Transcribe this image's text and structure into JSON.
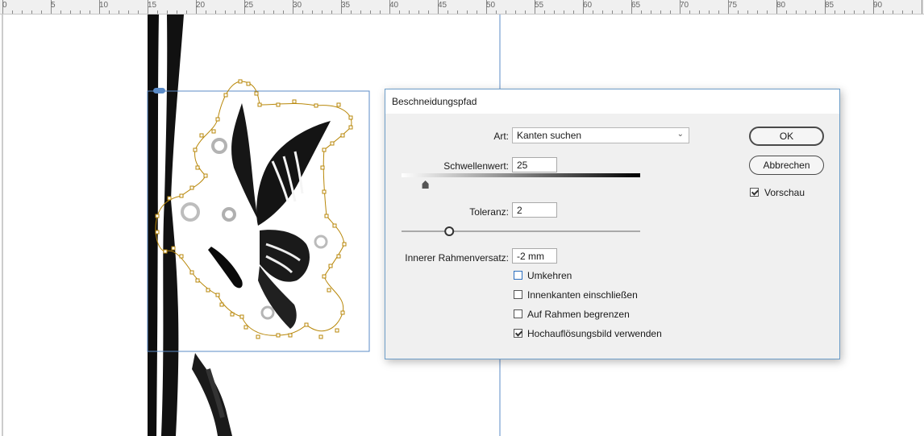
{
  "ruler": {
    "labels": [
      "0",
      "5",
      "10",
      "15",
      "20",
      "25",
      "30",
      "35",
      "40",
      "45",
      "50",
      "55",
      "60",
      "65",
      "70",
      "75",
      "80",
      "85",
      "90"
    ]
  },
  "dialog": {
    "title": "Beschneidungspfad",
    "type": {
      "label": "Art:",
      "value": "Kanten suchen"
    },
    "threshold": {
      "label": "Schwellenwert:",
      "value": "25",
      "slider_fraction": 0.1
    },
    "tolerance": {
      "label": "Toleranz:",
      "value": "2",
      "slider_fraction": 0.2
    },
    "inset": {
      "label": "Innerer Rahmenversatz:",
      "value": "-2 mm"
    },
    "checkboxes": [
      {
        "label": "Umkehren",
        "checked": false
      },
      {
        "label": "Innenkanten einschließen",
        "checked": false
      },
      {
        "label": "Auf Rahmen begrenzen",
        "checked": false
      },
      {
        "label": "Hochauflösungsbild verwenden",
        "checked": true
      }
    ],
    "ok_label": "OK",
    "cancel_label": "Abbrechen",
    "preview": {
      "label": "Vorschau",
      "checked": true
    }
  }
}
